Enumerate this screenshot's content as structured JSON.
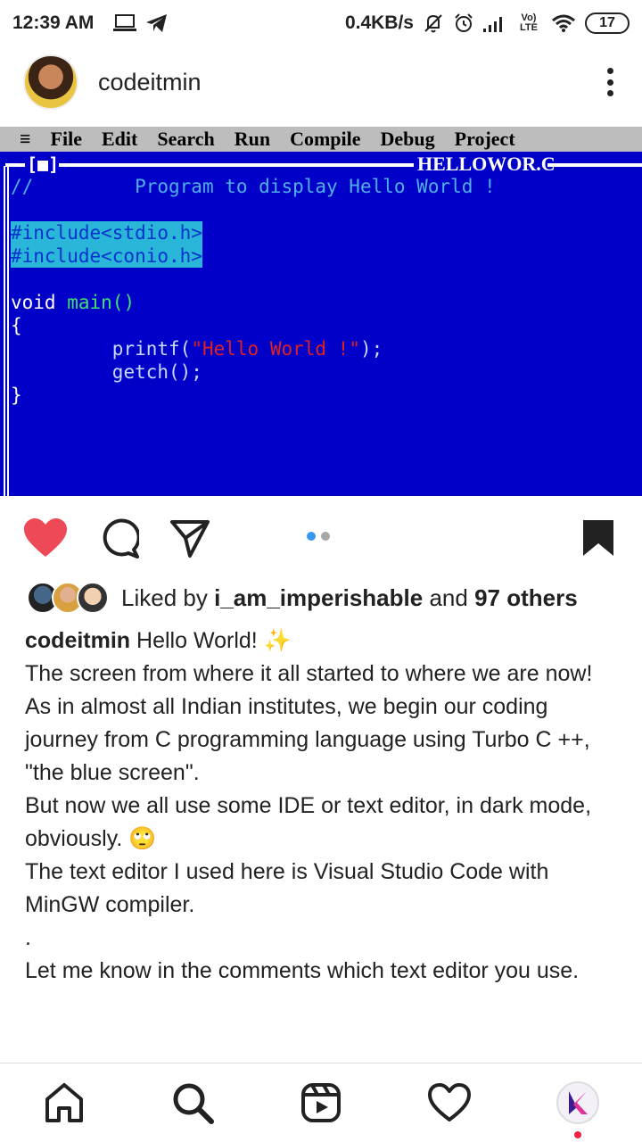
{
  "status_bar": {
    "time": "12:39 AM",
    "net_speed": "0.4KB/s",
    "carrier_badge": "Vo) LTE",
    "battery": "17",
    "icons": [
      "laptop-icon",
      "telegram-icon",
      "mute-bell-icon",
      "alarm-icon",
      "signal-icon",
      "volte-icon",
      "wifi-icon",
      "battery-icon"
    ]
  },
  "post": {
    "username": "codeitmin",
    "image": {
      "menu": [
        "File",
        "Edit",
        "Search",
        "Run",
        "Compile",
        "Debug",
        "Project"
      ],
      "window_marker": "[■]",
      "filename": "HELLOWOR.C",
      "code": {
        "comment_prefix": "//",
        "comment": "Program to display Hello World !",
        "include1": "#include<stdio.h>",
        "include2": "#include<conio.h>",
        "main_kw": "void",
        "main_fn": "main()",
        "open_brace": "{",
        "printf_call": "printf(",
        "printf_arg": "\"Hello World !\"",
        "printf_end": ");",
        "getch_call": "getch();",
        "close_brace": "}"
      },
      "colors": {
        "background": "#0000c8",
        "menubar": "#bdbdbd",
        "include_highlight": "#29b6d8",
        "string": "#e02020"
      }
    },
    "carousel": {
      "total": 2,
      "active": 1
    },
    "likes": {
      "prefix": "Liked by",
      "user": "i_am_imperishable",
      "middle": "and",
      "others": "97 others"
    },
    "caption": {
      "user": "codeitmin",
      "first_line": "Hello World! ✨",
      "lines": [
        "The screen from where it all started to where we are now!",
        "As in almost all Indian institutes, we begin our coding journey from C programming language using Turbo C ++, \"the blue screen\".",
        "But now we all use some IDE or text editor, in dark mode, obviously. 🙄",
        "The text editor I used here is Visual Studio Code with MinGW compiler.",
        ".",
        "Let me know in the comments which text editor you use."
      ]
    },
    "liked": true,
    "saved": true
  },
  "bottom_nav": {
    "items": [
      "home-icon",
      "search-icon",
      "reels-icon",
      "activity-heart-icon",
      "profile-avatar"
    ],
    "notification_dot_color": "#ee2244"
  }
}
